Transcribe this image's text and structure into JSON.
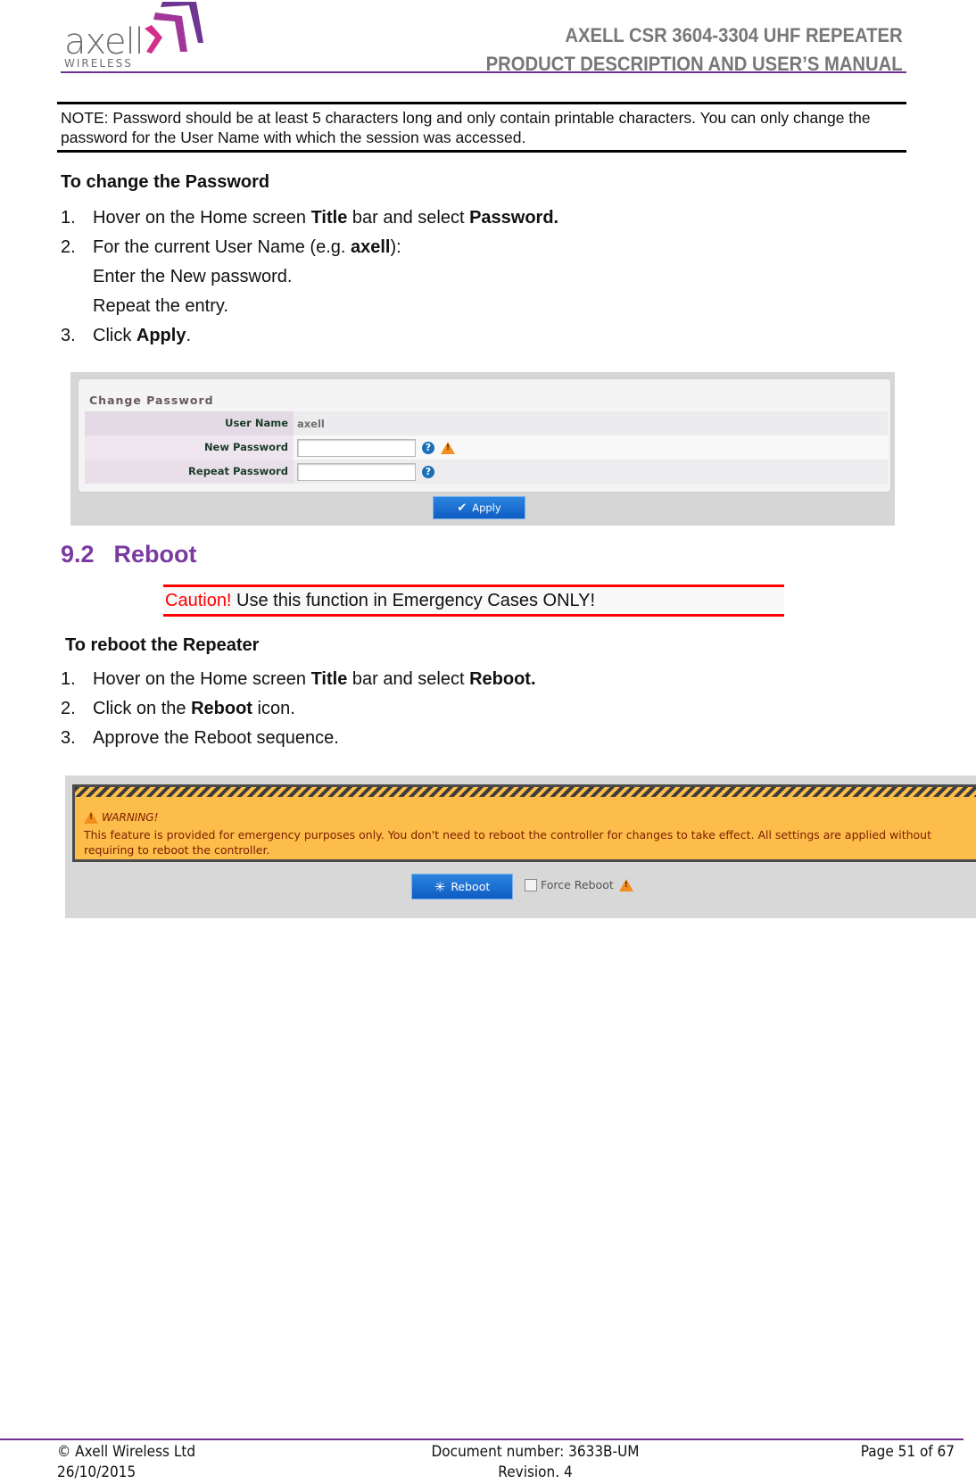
{
  "header": {
    "logo_word": "axell",
    "logo_sub": "WIRELESS",
    "title_line1": "AXELL CSR 3604-3304 UHF REPEATER",
    "title_line2": "PRODUCT DESCRIPTION AND USER’S MANUAL"
  },
  "note": "NOTE: Password should be at least 5 characters long and only contain printable characters. You can only change the password for the User Name with which the session was accessed.",
  "change_password": {
    "heading": "To change the Password",
    "steps": [
      {
        "num": "1.",
        "parts": [
          "Hover on the Home screen ",
          "Title",
          " bar and select ",
          "Password."
        ]
      },
      {
        "num": "2.",
        "parts": [
          "For the current User Name (e.g. ",
          "axell",
          "):"
        ]
      },
      {
        "num": "",
        "text": "Enter the New password."
      },
      {
        "num": "",
        "text": "Repeat the entry."
      },
      {
        "num": "3.",
        "parts": [
          "Click ",
          "Apply",
          "."
        ]
      }
    ],
    "screenshot": {
      "panel_title": "Change Password",
      "fields": [
        {
          "label": "User Name",
          "value": "axell"
        },
        {
          "label": "New Password",
          "value": ""
        },
        {
          "label": "Repeat Password",
          "value": ""
        }
      ],
      "help_glyph": "?",
      "warn_glyph": "!",
      "apply_label": "Apply",
      "apply_glyph": "✔"
    }
  },
  "section": {
    "number": "9.2",
    "title": "Reboot",
    "caution_label": "Caution!",
    "caution_text": " Use this function in Emergency Cases ONLY!"
  },
  "reboot": {
    "heading": "To reboot the Repeater",
    "steps": [
      {
        "num": "1.",
        "parts": [
          "Hover on the Home screen ",
          "Title",
          " bar and select ",
          "Reboot."
        ]
      },
      {
        "num": "2.",
        "parts": [
          "Click on the ",
          "Reboot",
          " icon."
        ]
      },
      {
        "num": "3.",
        "text": "Approve the Reboot sequence."
      }
    ],
    "screenshot": {
      "warning_title": "WARNING!",
      "warning_text": "This feature is provided for emergency purposes only. You don't need to reboot the controller for changes to take effect. All settings are applied without requiring to reboot the controller.",
      "reboot_label": "Reboot",
      "reboot_glyph": "✳",
      "force_reboot_label": "Force Reboot",
      "force_reboot_checked": false
    }
  },
  "footer": {
    "copyright": "© Axell Wireless Ltd",
    "date": "26/10/2015",
    "doc_number": "Document number: 3633B-UM",
    "revision": "Revision. 4",
    "page": "Page 51 of 67"
  },
  "colors": {
    "brand_purple": "#6e2f8e",
    "section_heading": "#7b3aa0",
    "caution_red": "#ff0000",
    "warning_orange": "#fdbd4a",
    "button_blue": "#1b6fd0"
  }
}
